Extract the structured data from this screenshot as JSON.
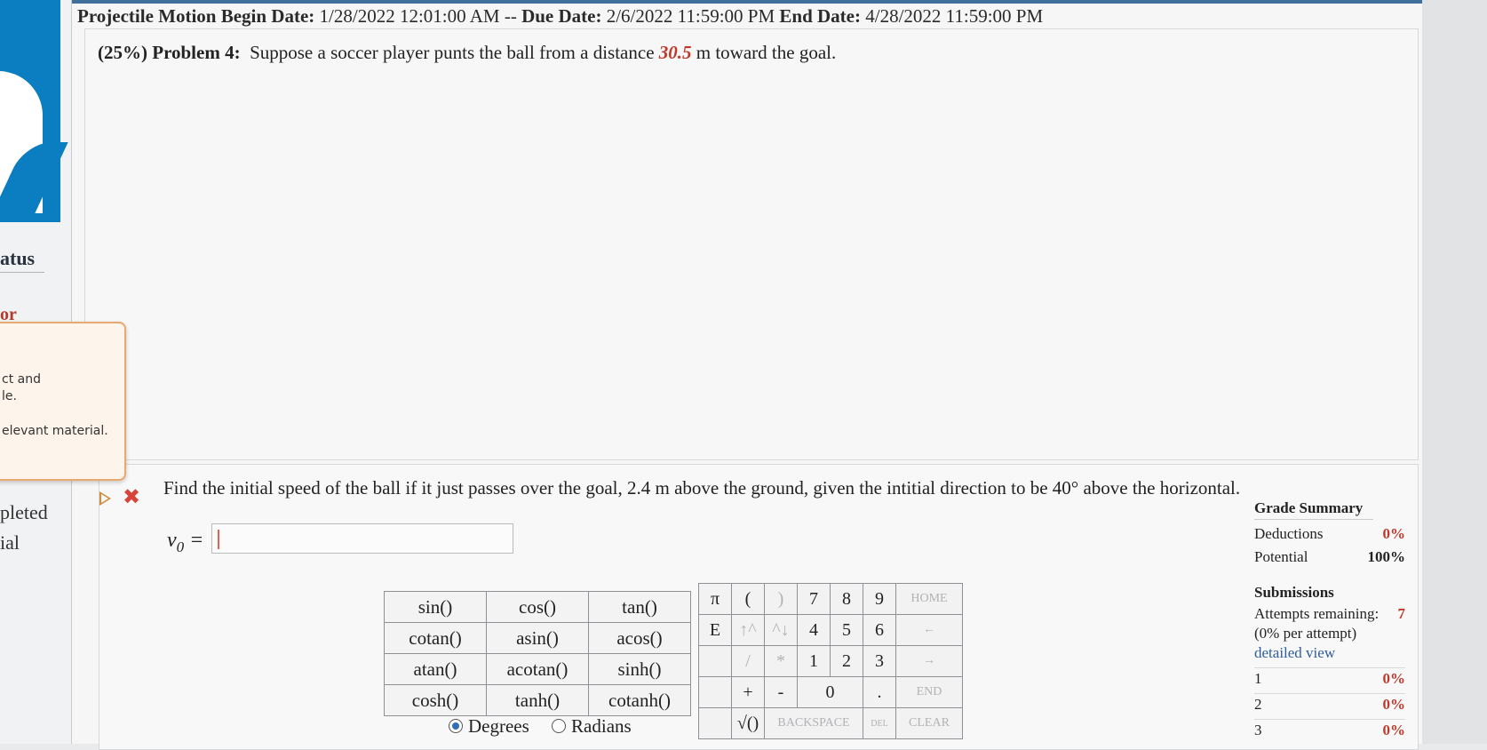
{
  "header": {
    "assignment": "Projectile Motion",
    "begin_label": "Begin Date:",
    "begin_value": "1/28/2022 12:01:00 AM",
    "separator": "--",
    "due_label": "Due Date:",
    "due_value": "2/6/2022 11:59:00 PM",
    "end_label": "End Date:",
    "end_value": "4/28/2022 11:59:00 PM"
  },
  "problem": {
    "label": "(25%) Problem 4:",
    "text_before": "Suppose a soccer player punts the ball from a distance",
    "distance": "30.5",
    "text_after": "m toward the goal."
  },
  "part": {
    "question": "Find the initial speed of the ball if it just passes over the goal, 2.4 m above the ground, given the intitial direction to be 40° above the horizontal.",
    "answer_var": "v",
    "answer_sub": "0",
    "answer_eq": " =",
    "answer_value": ""
  },
  "sidebar": {
    "status_frag": "atus",
    "or_frag": "or",
    "tooltip_line1": "ct and",
    "tooltip_line2": "le.",
    "tooltip_line3": "elevant material.",
    "under_frag": "pleted",
    "pleted_frag": "pleted",
    "ial_frag": "ial"
  },
  "keypad": {
    "functions": [
      [
        "sin()",
        "cos()",
        "tan()"
      ],
      [
        "cotan()",
        "asin()",
        "acos()"
      ],
      [
        "atan()",
        "acotan()",
        "sinh()"
      ],
      [
        "cosh()",
        "tanh()",
        "cotanh()"
      ]
    ],
    "degrees_label": "Degrees",
    "radians_label": "Radians",
    "pi": "π",
    "e": "E",
    "lparen": "(",
    "rparen": ")",
    "up": "↑^",
    "down": "^↓",
    "slash": "/",
    "star": "*",
    "plus": "+",
    "minus": "-",
    "dot": ".",
    "sqrt": "√()",
    "n7": "7",
    "n8": "8",
    "n9": "9",
    "n4": "4",
    "n5": "5",
    "n6": "6",
    "n1": "1",
    "n2": "2",
    "n3": "3",
    "n0": "0",
    "home": "HOME",
    "left": "←",
    "right": "→",
    "end": "END",
    "backspace": "BACKSPACE",
    "del": "DEL",
    "clear": "CLEAR"
  },
  "grade_summary": {
    "title": "Grade Summary",
    "deductions_label": "Deductions",
    "deductions_value": "0%",
    "potential_label": "Potential",
    "potential_value": "100%"
  },
  "submissions": {
    "title": "Submissions",
    "attempts_label": "Attempts remaining:",
    "attempts_value": "7",
    "per_attempt": "(0% per attempt)",
    "detailed_link": "detailed view",
    "rows": [
      {
        "n": "1",
        "v": "0%"
      },
      {
        "n": "2",
        "v": "0%"
      },
      {
        "n": "3",
        "v": "0%"
      }
    ]
  }
}
